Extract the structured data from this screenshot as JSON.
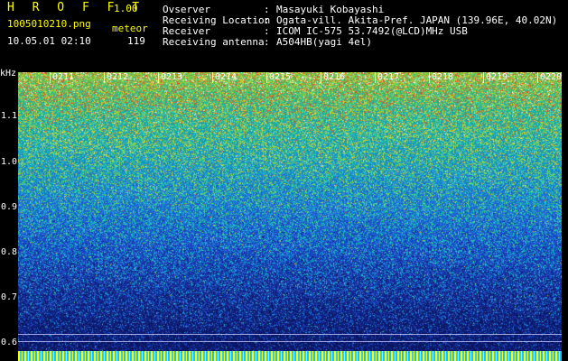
{
  "header": {
    "brand": "H R O F F T",
    "version": "1.00",
    "filename": "1005010210.png",
    "mode": "meteor",
    "datetime": "10.05.01 02:10",
    "count": "119",
    "fields": [
      {
        "label": "Ovserver",
        "colon": ":",
        "value": "Masayuki Kobayashi"
      },
      {
        "label": "Receiving Location",
        "colon": ":",
        "value": "Ogata-vill. Akita-Pref. JAPAN (139.96E, 40.02N)"
      },
      {
        "label": "Receiver",
        "colon": ":",
        "value": "ICOM IC-575 53.7492(@LCD)MHz USB"
      },
      {
        "label": "Receiving antenna",
        "colon": ":",
        "value": "A504HB(yagi 4el)"
      }
    ]
  },
  "axis": {
    "unit": "kHz",
    "y_ticks": [
      "1.1",
      "1.0",
      "0.9",
      "0.8",
      "0.7",
      "0.6"
    ],
    "x_ticks": [
      "0211",
      "0212",
      "0213",
      "0214",
      "0215",
      "0216",
      "0217",
      "0218",
      "0219",
      "0220"
    ]
  },
  "colors": {
    "header_yellow": "#ffff00",
    "header_white": "#ffffff",
    "background": "#000000"
  }
}
